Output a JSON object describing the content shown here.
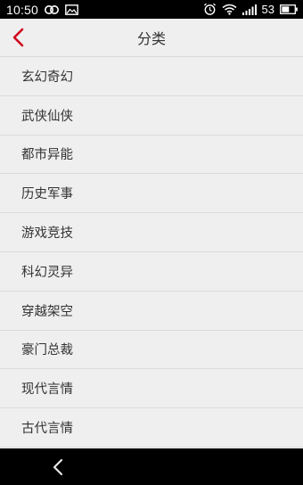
{
  "status_bar": {
    "time": "10:50",
    "battery_level": "53",
    "icons": [
      "link-icon",
      "image-icon",
      "alarm-icon",
      "wifi-icon",
      "signal-icon",
      "battery-icon"
    ]
  },
  "header": {
    "title": "分类",
    "back_icon": "chevron-left-icon",
    "accent_color": "#d0021b"
  },
  "categories": [
    "玄幻奇幻",
    "武侠仙侠",
    "都市异能",
    "历史军事",
    "游戏竞技",
    "科幻灵异",
    "穿越架空",
    "豪门总裁",
    "现代言情",
    "古代言情"
  ],
  "nav_bar": {
    "back_icon": "nav-back-icon"
  }
}
